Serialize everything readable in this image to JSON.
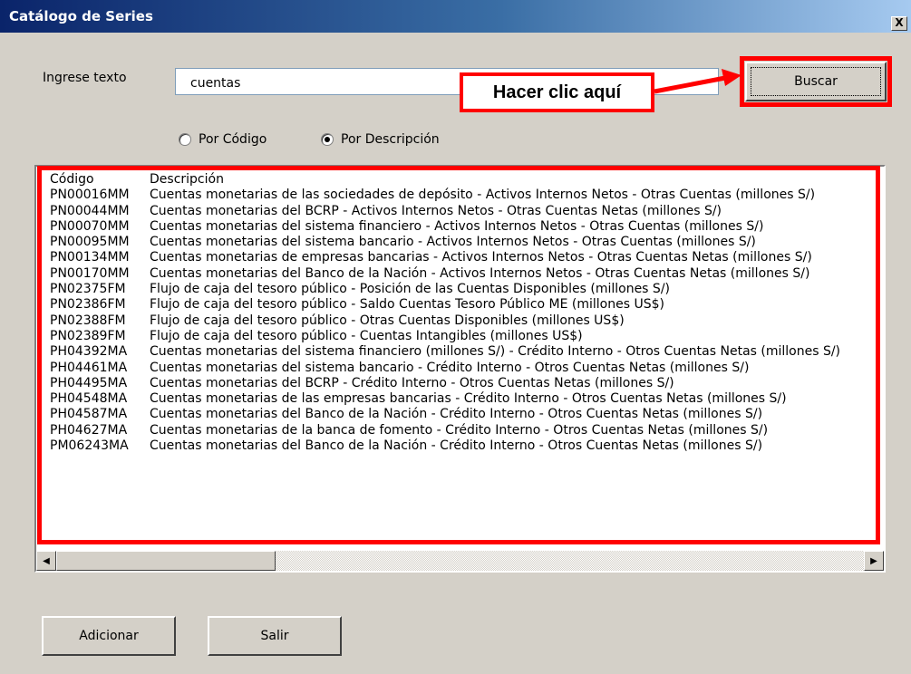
{
  "window": {
    "title": "Catálogo de Series",
    "close_label": "X"
  },
  "search": {
    "label": "Ingrese texto",
    "value": "cuentas",
    "button_label": "Buscar"
  },
  "callout": {
    "text": "Hacer clic aquí"
  },
  "radios": [
    {
      "label": "Por Código",
      "checked": false
    },
    {
      "label": "Por Descripción",
      "checked": true
    }
  ],
  "list": {
    "headers": {
      "code": "Código",
      "description": "Descripción"
    },
    "rows": [
      {
        "code": "PN00016MM",
        "description": "Cuentas monetarias de las sociedades de depósito - Activos Internos Netos - Otras Cuentas (millones S/)"
      },
      {
        "code": "PN00044MM",
        "description": "Cuentas monetarias del BCRP - Activos Internos Netos - Otras Cuentas Netas (millones S/)"
      },
      {
        "code": "PN00070MM",
        "description": "Cuentas monetarias del sistema financiero - Activos Internos Netos - Otras Cuentas (millones S/)"
      },
      {
        "code": "PN00095MM",
        "description": "Cuentas monetarias del sistema bancario - Activos Internos Netos - Otras Cuentas (millones S/)"
      },
      {
        "code": "PN00134MM",
        "description": "Cuentas monetarias de empresas bancarias - Activos Internos Netos - Otras Cuentas Netas (millones S/)"
      },
      {
        "code": "PN00170MM",
        "description": "Cuentas monetarias del Banco de la Nación - Activos Internos Netos - Otras Cuentas Netas (millones S/)"
      },
      {
        "code": "PN02375FM",
        "description": "Flujo de caja del tesoro público - Posición de las Cuentas Disponibles (millones S/)"
      },
      {
        "code": "PN02386FM",
        "description": "Flujo de caja del tesoro público - Saldo Cuentas Tesoro Público ME (millones US$)"
      },
      {
        "code": "PN02388FM",
        "description": "Flujo de caja del tesoro público - Otras Cuentas Disponibles (millones US$)"
      },
      {
        "code": "PN02389FM",
        "description": "Flujo de caja del tesoro público - Cuentas Intangibles (millones US$)"
      },
      {
        "code": "PH04392MA",
        "description": "Cuentas monetarias del sistema financiero (millones S/) - Crédito Interno - Otros Cuentas Netas (millones S/)"
      },
      {
        "code": "PH04461MA",
        "description": "Cuentas monetarias del sistema bancario - Crédito Interno - Otros Cuentas Netas (millones S/)"
      },
      {
        "code": "PH04495MA",
        "description": "Cuentas monetarias del BCRP - Crédito Interno - Otros Cuentas Netas (millones S/)"
      },
      {
        "code": "PH04548MA",
        "description": "Cuentas monetarias de las empresas bancarias - Crédito Interno - Otros Cuentas Netas (millones S/)"
      },
      {
        "code": "PH04587MA",
        "description": "Cuentas monetarias del Banco de la Nación - Crédito Interno - Otros Cuentas Netas (millones S/)"
      },
      {
        "code": "PH04627MA",
        "description": "Cuentas monetarias de la banca de fomento - Crédito Interno - Otros Cuentas Netas (millones S/)"
      },
      {
        "code": "PM06243MA",
        "description": "Cuentas monetarias del Banco de la Nación - Crédito Interno - Otros Cuentas Netas (millones S/)"
      }
    ]
  },
  "buttons": {
    "add_label": "Adicionar",
    "exit_label": "Salir"
  },
  "colors": {
    "highlight": "#ff0000",
    "titlebar": "#0a246a",
    "dialog_bg": "#d4d0c8"
  },
  "icons": {
    "scroll_left": "scroll-left-arrow-icon",
    "scroll_right": "scroll-right-arrow-icon",
    "arrow": "red-arrow-icon"
  }
}
